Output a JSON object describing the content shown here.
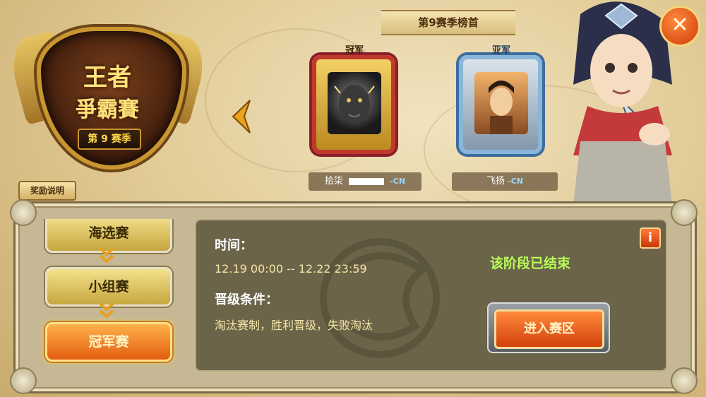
{
  "header": {
    "logo": {
      "line1": "王者",
      "line2": "爭霸賽",
      "season": "第 9 赛季"
    },
    "reward_button": "奖励说明",
    "banner": "第9赛季榜首"
  },
  "podium": {
    "champion": {
      "rank": "冠军",
      "name": "拾柒",
      "server": "-CN"
    },
    "runner_up": {
      "rank": "亚军",
      "name": "飞扬",
      "server": "-CN"
    }
  },
  "stages": {
    "items": [
      {
        "label": "海选赛"
      },
      {
        "label": "小组赛"
      },
      {
        "label": "冠军赛"
      }
    ],
    "active_index": 2
  },
  "details": {
    "time_label": "时间：",
    "time_value": "12.19 00:00 -- 12.22 23:59",
    "condition_label": "晋级条件：",
    "condition_value": "淘汰赛制，胜利晋级，失败淘汰",
    "status": "该阶段已结束",
    "info_icon": "i",
    "enter_button": "进入赛区"
  },
  "icons": {
    "close": "close-icon",
    "prev": "chevron-left-icon",
    "next": "chevron-right-icon"
  },
  "colors": {
    "accent_orange": "#e35d10",
    "status_green": "#b8ff58",
    "gold": "#c99630"
  }
}
